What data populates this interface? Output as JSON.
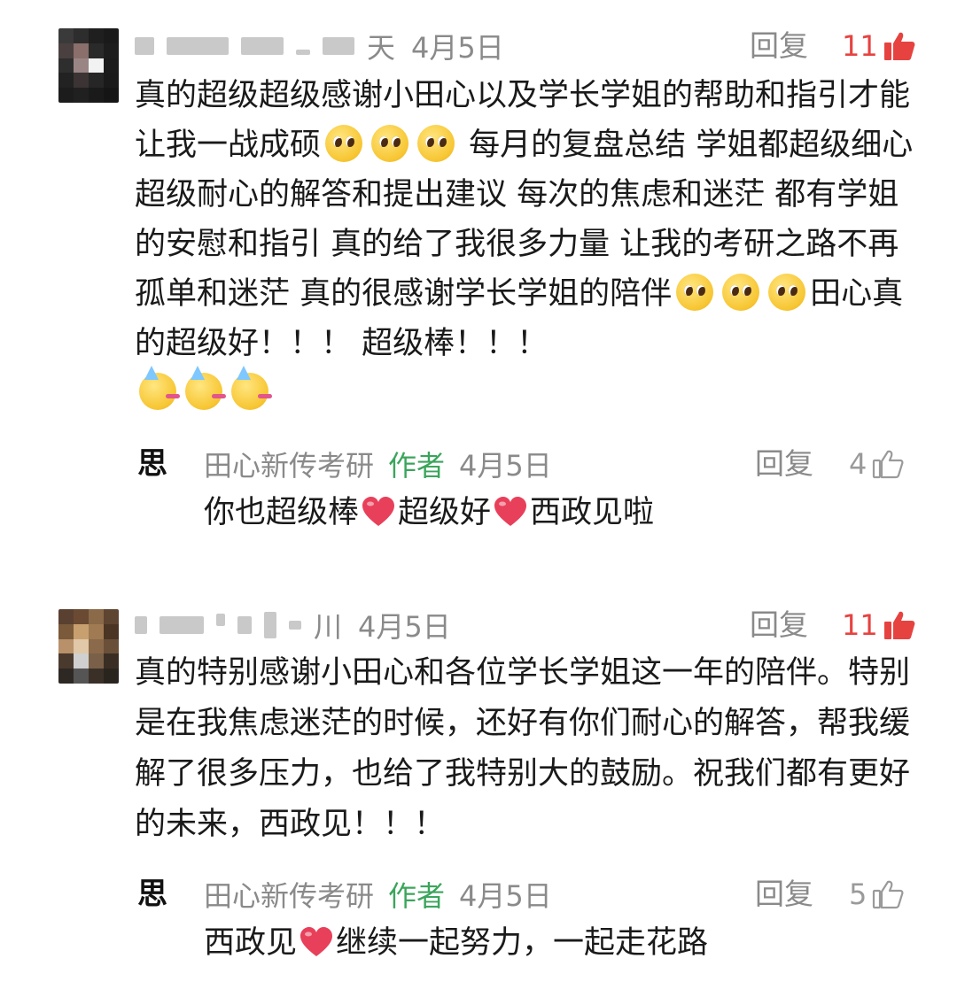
{
  "comments": [
    {
      "name_suffix": "天",
      "date": "4月5日",
      "reply_label": "回复",
      "likes": "11",
      "liked": true,
      "text_part1": "真的超级超级感谢小田心以及学长学姐的帮助和指引才能让我一战成硕",
      "text_part2": " 每月的复盘总结 学姐都超级细心超级耐心的解答和提出建议 每次的焦虑和迷茫 都有学姐的安慰和指引 真的给了我很多力量 让我的考研之路不再孤单和迷茫 真的很感谢学长学姐的陪伴",
      "text_part3": "田心真的超级好！！！ 超级棒！！！",
      "author_reply": {
        "author_name": "田心新传考研",
        "author_tag": "作者",
        "date": "4月5日",
        "reply_label": "回复",
        "likes": "4",
        "text_part1": "你也超级棒",
        "text_part2": "超级好",
        "text_part3": "西政见啦"
      }
    },
    {
      "name_suffix": "川",
      "date": "4月5日",
      "reply_label": "回复",
      "likes": "11",
      "liked": true,
      "text": "真的特别感谢小田心和各位学长学姐这一年的陪伴。特别是在我焦虑迷茫的时候，还好有你们耐心的解答，帮我缓解了很多压力，也给了我特别大的鼓励。祝我们都有更好的未来，西政见！！！",
      "author_reply": {
        "author_name": "田心新传考研",
        "author_tag": "作者",
        "date": "4月5日",
        "reply_label": "回复",
        "likes": "5",
        "text_part1": "西政见",
        "text_part2": "继续一起努力，一起走花路"
      }
    }
  ],
  "author_logo_char": "思",
  "icons": {
    "like_filled": "thumbs-up-filled-icon",
    "like_outline": "thumbs-up-outline-icon",
    "emoji_pleading": "pleading-face-emoji",
    "emoji_party": "partying-face-emoji",
    "heart": "red-heart-emoji"
  },
  "colors": {
    "like_active": "#e64340",
    "meta_grey": "#8a8a8a",
    "author_green": "#3ba55c",
    "heart_red": "#e8405a"
  }
}
